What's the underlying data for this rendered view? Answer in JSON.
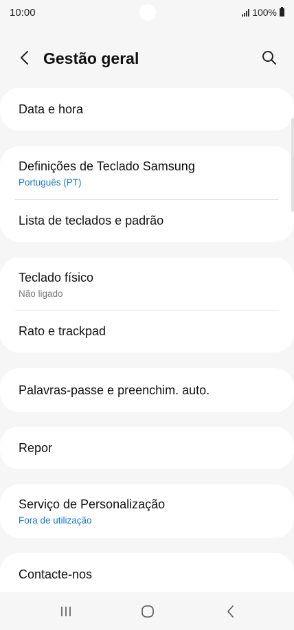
{
  "status_bar": {
    "time": "10:00",
    "battery_text": "100%"
  },
  "header": {
    "title": "Gestão geral",
    "back_icon": "chevron-left-icon",
    "search_icon": "search-icon"
  },
  "items": {
    "date_time": {
      "title": "Data e hora"
    },
    "samsung_keyboard": {
      "title": "Definições de Teclado Samsung",
      "subtitle": "Português (PT)"
    },
    "keyboard_list": {
      "title": "Lista de teclados e padrão"
    },
    "physical_keyboard": {
      "title": "Teclado físico",
      "subtitle": "Não ligado"
    },
    "mouse_trackpad": {
      "title": "Rato e trackpad"
    },
    "passwords_autofill": {
      "title": "Palavras-passe e preenchim. auto."
    },
    "reset": {
      "title": "Repor"
    },
    "customization_service": {
      "title": "Serviço de Personalização",
      "subtitle": "Fora de utilização"
    },
    "contact_us": {
      "title": "Contacte-nos"
    }
  },
  "nav_bar": {
    "recents_icon": "recents-icon",
    "home_icon": "home-icon",
    "back_icon": "back-icon"
  },
  "colors": {
    "accent": "#1976d2",
    "background": "#f6f6f6",
    "card": "#ffffff",
    "secondary_text": "#777777"
  }
}
